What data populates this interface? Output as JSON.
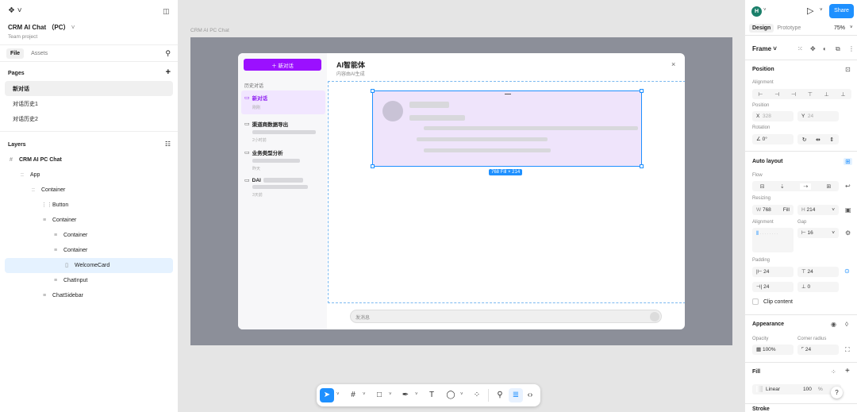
{
  "left": {
    "file_title": "CRM AI Chat （PC）",
    "team": "Team project",
    "tabs": [
      "File",
      "Assets"
    ],
    "pages_header": "Pages",
    "pages": [
      "新对话",
      "对话历史1",
      "对话历史2"
    ],
    "layers_header": "Layers",
    "layers": [
      {
        "label": "CRM AI PC Chat",
        "icon": "#"
      },
      {
        "label": "App",
        "icon": "::"
      },
      {
        "label": "Container",
        "icon": "::"
      },
      {
        "label": "Button",
        "icon": "⋮⋮"
      },
      {
        "label": "Container",
        "icon": "≡"
      },
      {
        "label": "Container",
        "icon": "≡"
      },
      {
        "label": "Container",
        "icon": "≡"
      },
      {
        "label": "WelcomeCard",
        "icon": "▯"
      },
      {
        "label": "ChatInput",
        "icon": "≡"
      },
      {
        "label": "ChatSidebar",
        "icon": "≡"
      }
    ]
  },
  "canvas": {
    "frame_label": "CRM AI PC Chat",
    "new_chat_label": "＋ 新对话",
    "history_header": "历史对话",
    "conversations": [
      {
        "title": "新对话",
        "sub": "刚刚"
      },
      {
        "title": "渠道商数据导出",
        "sub": "2小时前"
      },
      {
        "title": "业务类型分析",
        "sub": "昨天"
      },
      {
        "title": "DAI",
        "sub": "3天前"
      }
    ],
    "dialog_title": "AI智能体",
    "dialog_subtitle": "内容由AI生成",
    "close": "×",
    "size_badge": "768 Fill × 214",
    "input_placeholder": "发消息"
  },
  "toolbar": {
    "tools": [
      "move-icon",
      "frame-icon",
      "rectangle-icon",
      "pen-icon",
      "text-icon",
      "comment-icon",
      "actions-icon",
      "dev-mode-icon",
      "design-icon",
      "code-icon"
    ]
  },
  "right": {
    "avatar": "H",
    "share": "Share",
    "tabs": [
      "Design",
      "Prototype"
    ],
    "zoom": "75%",
    "frame_label": "Frame",
    "position": "Position",
    "alignment": "Alignment",
    "position_label": "Position",
    "x_label": "X",
    "x_value": "328",
    "y_label": "Y",
    "y_value": "24",
    "rotation_label": "Rotation",
    "rotation_value": "0°",
    "auto_layout": "Auto layout",
    "flow": "Flow",
    "resizing": "Resizing",
    "w_label": "W",
    "w_value": "768",
    "w_mode": "Fill",
    "h_label": "H",
    "h_value": "214",
    "alignment2": "Alignment",
    "gap_label": "Gap",
    "gap_value": "16",
    "padding_label": "Padding",
    "padding": [
      "24",
      "24",
      "24",
      "0"
    ],
    "clip_content": "Clip content",
    "appearance": "Appearance",
    "opacity_label": "Opacity",
    "opacity_value": "100%",
    "corner_label": "Corner radius",
    "corner_value": "24",
    "fill": "Fill",
    "fill_type": "Linear",
    "fill_opacity": "100",
    "fill_pct": "%",
    "stroke": "Stroke",
    "help": "?"
  }
}
